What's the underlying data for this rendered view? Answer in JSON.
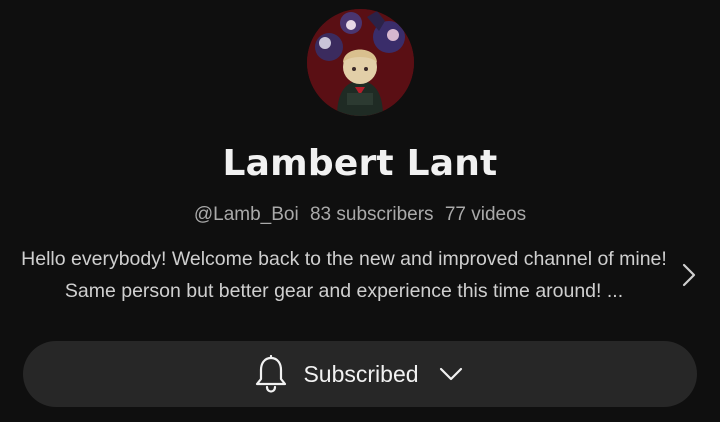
{
  "channel": {
    "name": "Lambert Lant",
    "handle": "@Lamb_Boi",
    "subscribers": "83 subscribers",
    "videos": "77 videos",
    "description": "Hello everybody! Welcome back to the new and improved channel of mine! Same person but better gear and experience this time around! ..."
  },
  "subscribe": {
    "label": "Subscribed"
  },
  "icons": {
    "avatar": "channel-avatar",
    "bell": "bell-icon",
    "dropdown": "chevron-down-icon",
    "more": "chevron-right-icon"
  },
  "colors": {
    "background": "#0f0f0f",
    "button": "#272727",
    "secondary_text": "#aaaaaa"
  }
}
